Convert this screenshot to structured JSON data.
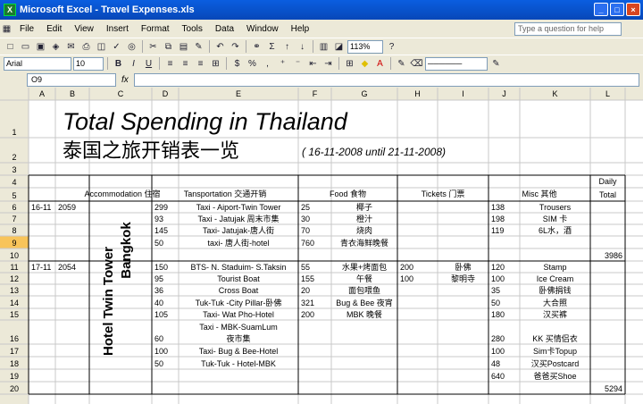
{
  "window": {
    "title": "Microsoft Excel - Travel Expenses.xls",
    "min": "_",
    "max": "□",
    "close": "×",
    "app_icon": "X"
  },
  "menu": [
    "File",
    "Edit",
    "View",
    "Insert",
    "Format",
    "Tools",
    "Data",
    "Window",
    "Help"
  ],
  "help_placeholder": "Type a question for help",
  "toolbar": {
    "zoom": "113%",
    "font": "Arial",
    "size": "10",
    "bold": "B",
    "italic": "I",
    "underline": "U"
  },
  "name_box": "O9",
  "fx_label": "fx",
  "columns": [
    "A",
    "B",
    "C",
    "D",
    "E",
    "F",
    "G",
    "H",
    "I",
    "J",
    "K",
    "L"
  ],
  "rows": [
    "1",
    "2",
    "3",
    "4",
    "5",
    "6",
    "7",
    "8",
    "9",
    "10",
    "11",
    "12",
    "13",
    "14",
    "15",
    "16",
    "17",
    "18",
    "19",
    "20"
  ],
  "sheet": {
    "title_en": "Total Spending in Thailand",
    "title_zh": "泰国之旅开销表一览",
    "date_range": "( 16-11-2008 until 21-11-2008)",
    "headers": {
      "accommodation": "Accommodation 住宿",
      "transportation": "Tansportation 交通开销",
      "food": "Food 食物",
      "tickets": "Tickets 门票",
      "misc": "Misc 其他",
      "daily_total_1": "Daily",
      "daily_total_2": "Total"
    },
    "hotel_line1": "Hotel Twin Tower",
    "hotel_line2": "Bangkok",
    "cells": {
      "A6": "16-11",
      "B6": "2059",
      "D6": "299",
      "E6": "Taxi - Aiport-Twin Tower",
      "F6": "25",
      "G6": "椰子",
      "J6": "138",
      "K6": "Trousers",
      "D7": "93",
      "E7": "Taxi - Jatujak 周末市集",
      "F7": "30",
      "G7": "橙汁",
      "J7": "198",
      "K7": "SIM 卡",
      "D8": "145",
      "E8": "Taxi- Jatujak-唐人街",
      "F8": "70",
      "G8": "烧肉",
      "J8": "119",
      "K8": "6L水，酒",
      "D9": "50",
      "E9": "taxi- 唐人街-hotel",
      "F9": "760",
      "G9": "青衣海鲜晚餐",
      "L10": "3986",
      "A11": "17-11",
      "B11": "2054",
      "D11": "150",
      "E11": "BTS- N. Staduim- S.Taksin",
      "F11": "55",
      "G11": "水果+烤面包",
      "H11": "200",
      "I11": "卧佛",
      "J11": "120",
      "K11": "Stamp",
      "D12": "95",
      "E12": "Tourist Boat",
      "F12": "155",
      "G12": "午餐",
      "H12": "100",
      "I12": "黎明寺",
      "J12": "100",
      "K12": "Ice Cream",
      "D13": "36",
      "E13": "Cross Boat",
      "F13": "20",
      "G13": "面包喂鱼",
      "J13": "35",
      "K13": "卧佛捐钱",
      "D14": "40",
      "E14": "Tuk-Tuk -City Pillar-卧佛",
      "F14": "321",
      "G14": "Bug & Bee 夜宵",
      "J14": "50",
      "K14": "大合照",
      "D15": "105",
      "E15": "Taxi- Wat Pho-Hotel",
      "F15": "200",
      "G15": "MBK 晚餐",
      "J15": "180",
      "K15": "汉买裤",
      "E16a": "Taxi - MBK-SuamLum",
      "E16b": "夜市集",
      "D16": "60",
      "J16": "280",
      "K16": "KK 买情侣衣",
      "D17": "100",
      "E17": "Taxi- Bug & Bee-Hotel",
      "J17": "100",
      "K17": "Sim卡Topup",
      "D18": "50",
      "E18": "Tuk-Tuk - Hotel-MBK",
      "J18": "48",
      "K18": "汉买Postcard",
      "J19": "640",
      "K19": "爸爸买Shoe",
      "L20": "5294"
    }
  }
}
